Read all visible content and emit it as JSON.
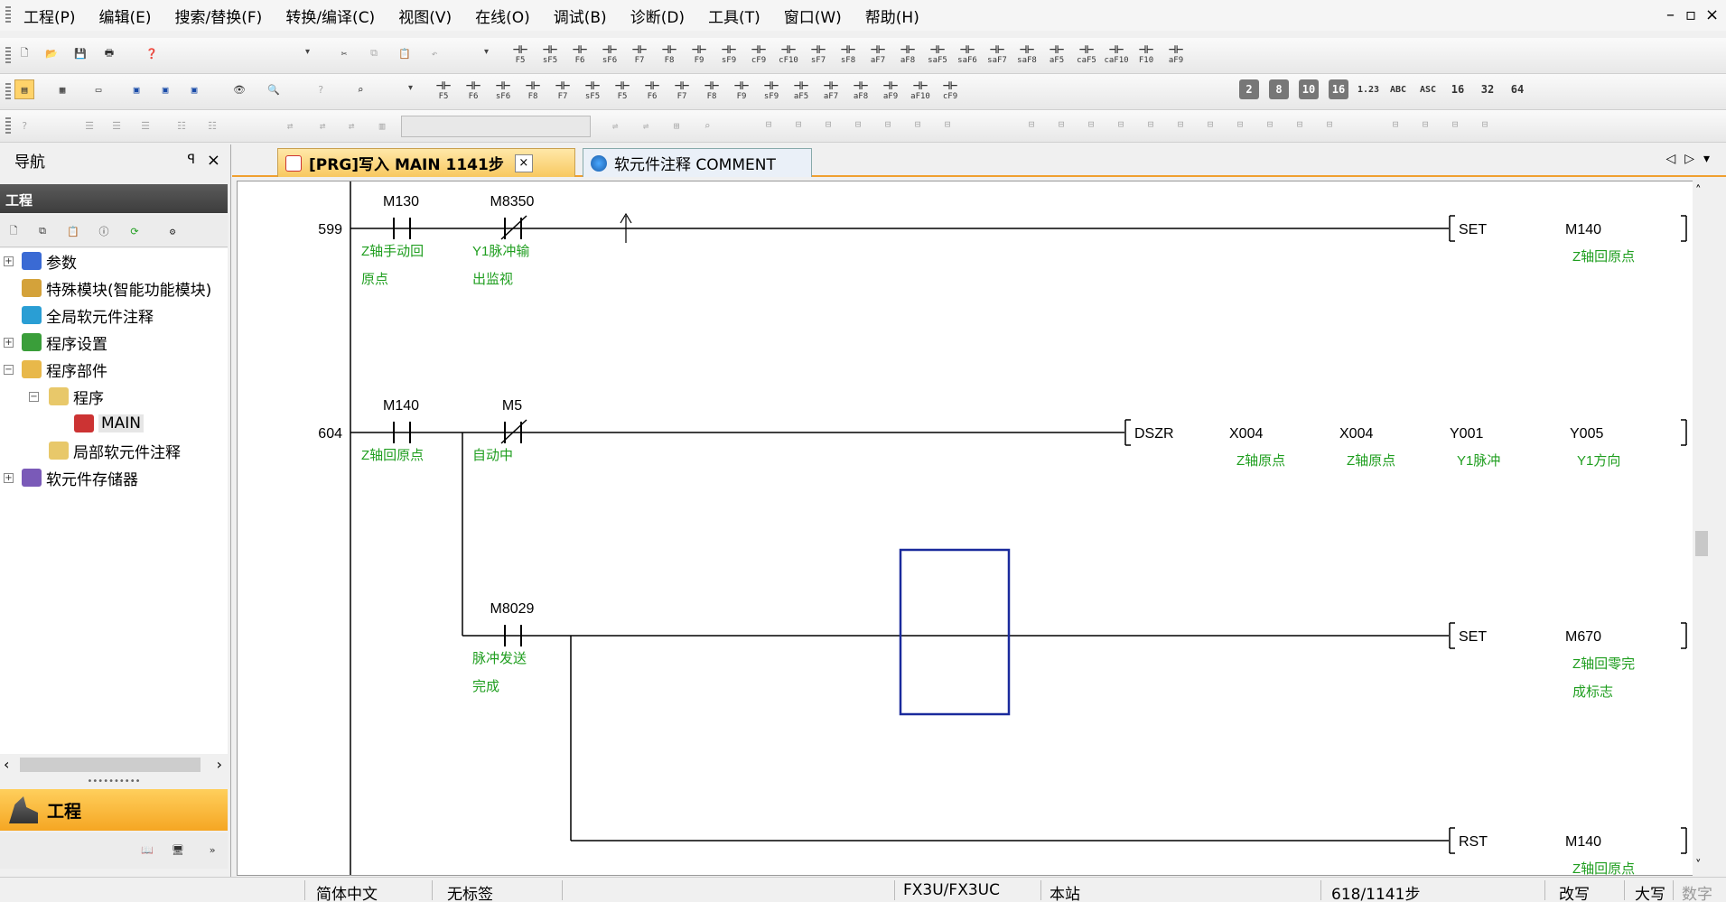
{
  "menu": [
    "工程(P)",
    "编辑(E)",
    "搜索/替换(F)",
    "转换/编译(C)",
    "视图(V)",
    "在线(O)",
    "调试(B)",
    "诊断(D)",
    "工具(T)",
    "窗口(W)",
    "帮助(H)"
  ],
  "window_controls": [
    "–",
    "▫",
    "×"
  ],
  "toolbar_keys": {
    "row1": [
      "F5",
      "sF5",
      "F6",
      "sF6",
      "F7",
      "F8",
      "F9",
      "sF9",
      "cF9",
      "cF10",
      "sF7",
      "sF8",
      "aF7",
      "aF8",
      "saF5",
      "saF6",
      "saF7",
      "saF8",
      "aF5",
      "caF5",
      "caF10",
      "F10",
      "aF9"
    ],
    "row2": [
      "F5",
      "F6",
      "sF6",
      "F8",
      "F7",
      "sF5",
      "F5",
      "F6",
      "F7",
      "F8",
      "F9",
      "sF9",
      "aF5",
      "aF7",
      "aF8",
      "aF9",
      "aF10",
      "cF9"
    ],
    "row2_num": [
      "2",
      "8",
      "10",
      "16",
      "1.23",
      "ABC",
      "ASC",
      "16",
      "32",
      "64"
    ]
  },
  "nav": {
    "header": "导航",
    "pin": "ꟼ",
    "close": "×",
    "title": "工程",
    "tree": [
      {
        "label": "参数",
        "expander": "+"
      },
      {
        "label": "特殊模块(智能功能模块)",
        "expander": ""
      },
      {
        "label": "全局软元件注释",
        "expander": ""
      },
      {
        "label": "程序设置",
        "expander": "+"
      },
      {
        "label": "程序部件",
        "expander": "−"
      },
      {
        "label": "程序",
        "expander": "−"
      },
      {
        "label": "MAIN",
        "expander": ""
      },
      {
        "label": "局部软元件注释",
        "expander": ""
      },
      {
        "label": "软元件存储器",
        "expander": "+"
      }
    ],
    "project_button": "工程"
  },
  "tabs": [
    {
      "label": "[PRG]写入 MAIN 1141步",
      "active": true,
      "close": "×"
    },
    {
      "label": "软元件注释 COMMENT",
      "active": false
    }
  ],
  "ladder": {
    "rungs": [
      {
        "step": "599",
        "contacts": [
          {
            "device": "M130",
            "type": "NO",
            "comment": [
              "Z轴手动回",
              "原点"
            ]
          },
          {
            "device": "M8350",
            "type": "NC",
            "comment": [
              "Y1脉冲输",
              "出监视"
            ]
          }
        ],
        "instruction": "SET",
        "operands": [
          {
            "device": "M140",
            "comment": [
              "Z轴回原点"
            ]
          }
        ]
      },
      {
        "step": "604",
        "contacts": [
          {
            "device": "M140",
            "type": "NO",
            "comment": [
              "Z轴回原点"
            ]
          },
          {
            "device": "M5",
            "type": "NC",
            "comment": [
              "自动中"
            ]
          }
        ],
        "instruction": "DSZR",
        "operands": [
          {
            "device": "X004",
            "comment": [
              "Z轴原点"
            ]
          },
          {
            "device": "X004",
            "comment": [
              "Z轴原点"
            ]
          },
          {
            "device": "Y001",
            "comment": [
              "Y1脉冲"
            ]
          },
          {
            "device": "Y005",
            "comment": [
              "Y1方向"
            ]
          }
        ],
        "branches": [
          {
            "contact": {
              "device": "M8029",
              "type": "NO",
              "comment": [
                "脉冲发送",
                "完成"
              ]
            },
            "instruction": "SET",
            "operands": [
              {
                "device": "M670",
                "comment": [
                  "Z轴回零完",
                  "成标志"
                ]
              }
            ]
          },
          {
            "instruction": "RST",
            "operands": [
              {
                "device": "M140",
                "comment": [
                  "Z轴回原点"
                ]
              }
            ]
          }
        ]
      }
    ],
    "cursor_color": "#1a2a9c",
    "comment_color": "#1f9e1f"
  },
  "status": {
    "language": "简体中文",
    "label": "无标签",
    "cpu": "FX3U/FX3UC",
    "station": "本站",
    "steps": "618/1141步",
    "overwrite": "改写",
    "caps": "大写",
    "numlock": "数字"
  },
  "colors": {
    "accent": "#f5a623",
    "nav_title_bg": "#4a4a4a"
  }
}
